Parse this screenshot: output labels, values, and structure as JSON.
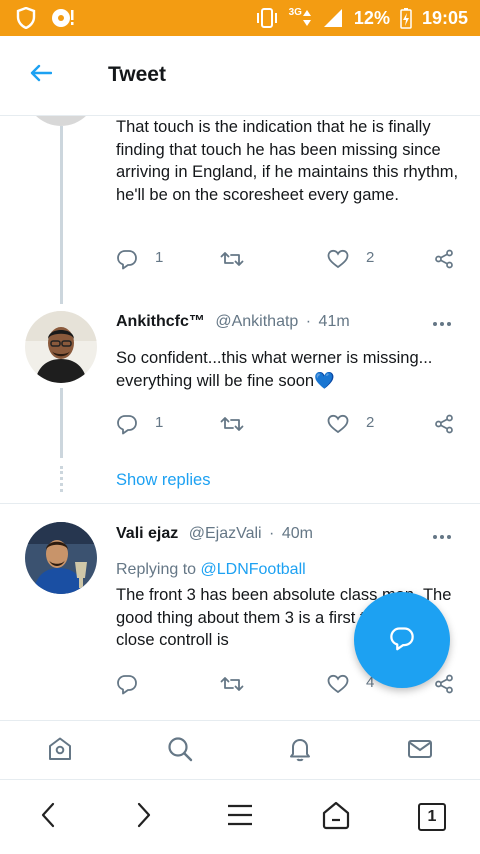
{
  "status_bar": {
    "network": "3G",
    "battery": "12%",
    "time": "19:05"
  },
  "header": {
    "title": "Tweet"
  },
  "tweets": [
    {
      "text": "That touch is the indication that he is finally finding that touch he has been missing since arriving in England, if he maintains this rhythm, he'll be on the scoresheet every game.",
      "replies": "1",
      "likes": "2"
    },
    {
      "name": "Ankithcfc™",
      "handle": "@Ankithatp",
      "time": "41m",
      "text": "So confident...this what werner is missing... everything will be fine soon💙",
      "replies": "1",
      "likes": "2"
    },
    {
      "name": "Vali ejaz",
      "handle": "@EjazVali",
      "time": "40m",
      "replying_prefix": "Replying to",
      "replying_to": "@LDNFootball",
      "text": "The front 3 has been absolute class man. The good thing about them 3 is a first touch and close controll is",
      "replies": "",
      "likes": "4"
    }
  ],
  "show_replies_label": "Show replies",
  "separator": "·",
  "icons": {
    "back": "back-arrow-icon",
    "reply": "reply-icon",
    "retweet": "retweet-icon",
    "like": "heart-icon",
    "share": "share-icon",
    "compose": "compose-reply-icon",
    "home": "home-icon",
    "search": "search-icon",
    "notifications": "bell-icon",
    "messages": "mail-icon"
  },
  "browser_nav": {
    "tab_count": "1"
  },
  "colors": {
    "accent": "#1da1f2",
    "status_bar": "#f39c12",
    "secondary_text": "#657786",
    "thread_line": "#ccd6dd"
  }
}
